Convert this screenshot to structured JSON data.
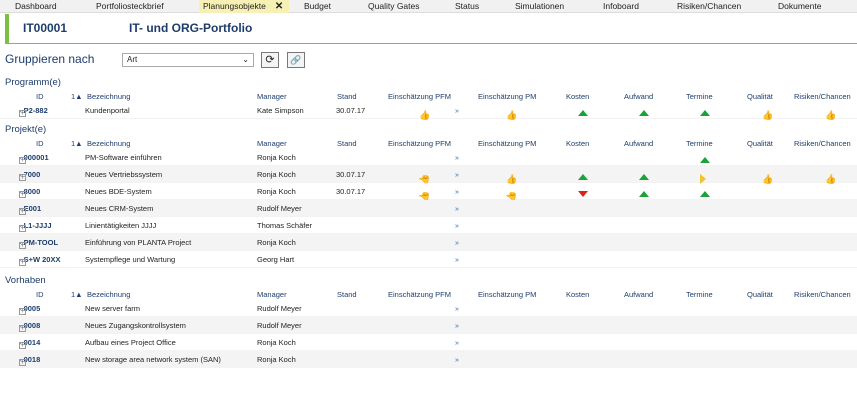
{
  "tabs": [
    "Dashboard",
    "Portfoliosteckbrief",
    "Planungsobjekte",
    "Budget",
    "Quality Gates",
    "Status",
    "Simulationen",
    "Infoboard",
    "Risiken/Chancen",
    "Dokumente"
  ],
  "active_tab_close": "✕",
  "title": {
    "id": "IT00001",
    "name": "IT- und ORG-Portfolio"
  },
  "group": {
    "label": "Gruppieren nach",
    "value": "Art"
  },
  "columns": {
    "id": "ID",
    "sort": "1▲",
    "bez": "Bezeichnung",
    "manager": "Manager",
    "stand": "Stand",
    "pfm": "Einschätzung PFM",
    "pm": "Einschätzung PM",
    "kosten": "Kosten",
    "aufwand": "Aufwand",
    "termine": "Termine",
    "qualitaet": "Qualität",
    "risiken": "Risiken/Chancen"
  },
  "sections": [
    {
      "name": "Programm(e)",
      "rows": [
        {
          "id": "P2-882",
          "bez": "Kundenportal",
          "manager": "Kate Simpson",
          "stand": "30.07.17",
          "pfm": "thumb-up",
          "pm": "thumb-up",
          "kosten": "up",
          "aufwand": "up",
          "termine": "up",
          "qualitaet": "thumb-up",
          "risiken": "thumb-up"
        }
      ]
    },
    {
      "name": "Projekt(e)",
      "rows": [
        {
          "id": "000001",
          "bez": "PM-Software einführen",
          "manager": "Ronja Koch",
          "stand": "",
          "pfm": "",
          "pm": "",
          "kosten": "",
          "aufwand": "",
          "termine": "up",
          "qualitaet": "",
          "risiken": ""
        },
        {
          "id": "7000",
          "bez": "Neues Vertriebssystem",
          "manager": "Ronja Koch",
          "stand": "30.07.17",
          "pfm": "thumb-side",
          "pm": "thumb-up",
          "kosten": "up",
          "aufwand": "up",
          "termine": "right",
          "qualitaet": "thumb-up",
          "risiken": "thumb-up"
        },
        {
          "id": "8000",
          "bez": "Neues BDE-System",
          "manager": "Ronja Koch",
          "stand": "30.07.17",
          "pfm": "thumb-side",
          "pm": "thumb-side",
          "kosten": "down",
          "aufwand": "up",
          "termine": "up",
          "qualitaet": "",
          "risiken": ""
        },
        {
          "id": "E001",
          "bez": "Neues CRM-System",
          "manager": "Rudolf Meyer",
          "stand": "",
          "pfm": "",
          "pm": "",
          "kosten": "",
          "aufwand": "",
          "termine": "",
          "qualitaet": "",
          "risiken": ""
        },
        {
          "id": "L1-JJJJ",
          "bez": "Linientätigkeiten JJJJ",
          "manager": "Thomas Schäfer",
          "stand": "",
          "pfm": "",
          "pm": "",
          "kosten": "",
          "aufwand": "",
          "termine": "",
          "qualitaet": "",
          "risiken": ""
        },
        {
          "id": "PM-TOOL",
          "bez": "Einführung von PLANTA Project",
          "manager": "Ronja Koch",
          "stand": "",
          "pfm": "",
          "pm": "",
          "kosten": "",
          "aufwand": "",
          "termine": "",
          "qualitaet": "",
          "risiken": ""
        },
        {
          "id": "S+W 20XX",
          "bez": "Systempflege und Wartung",
          "manager": "Georg Hart",
          "stand": "",
          "pfm": "",
          "pm": "",
          "kosten": "",
          "aufwand": "",
          "termine": "",
          "qualitaet": "",
          "risiken": ""
        }
      ]
    },
    {
      "name": "Vorhaben",
      "rows": [
        {
          "id": "0005",
          "bez": "New server farm",
          "manager": "Rudolf Meyer",
          "stand": "",
          "pfm": "",
          "pm": "",
          "kosten": "",
          "aufwand": "",
          "termine": "",
          "qualitaet": "",
          "risiken": ""
        },
        {
          "id": "0008",
          "bez": "Neues Zugangskontrollsystem",
          "manager": "Rudolf Meyer",
          "stand": "",
          "pfm": "",
          "pm": "",
          "kosten": "",
          "aufwand": "",
          "termine": "",
          "qualitaet": "",
          "risiken": ""
        },
        {
          "id": "0014",
          "bez": "Aufbau eines Project Office",
          "manager": "Ronja Koch",
          "stand": "",
          "pfm": "",
          "pm": "",
          "kosten": "",
          "aufwand": "",
          "termine": "",
          "qualitaet": "",
          "risiken": ""
        },
        {
          "id": "0018",
          "bez": "New storage area network system (SAN)",
          "manager": "Ronja Koch",
          "stand": "",
          "pfm": "",
          "pm": "",
          "kosten": "",
          "aufwand": "",
          "termine": "",
          "qualitaet": "",
          "risiken": ""
        }
      ]
    }
  ]
}
